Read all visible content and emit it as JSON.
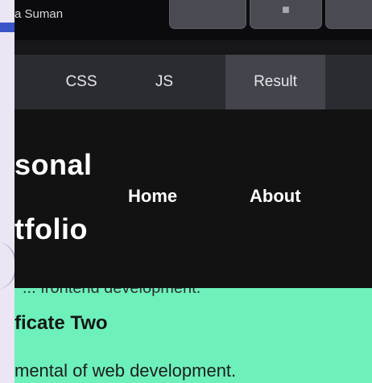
{
  "editor": {
    "author": "a Suman",
    "toolbar_buttons": [
      {
        "icon": "toolbar-button-icon"
      },
      {
        "icon": "toolbar-button-icon"
      },
      {
        "icon": "toolbar-button-icon"
      }
    ],
    "tabs": [
      {
        "label": "CSS",
        "active": false
      },
      {
        "label": "JS",
        "active": false
      },
      {
        "label": "Result",
        "active": true
      }
    ]
  },
  "result": {
    "logo": {
      "line1": "sonal",
      "line2": "tfolio"
    },
    "nav": {
      "home": "Home",
      "about": "About"
    },
    "content": {
      "cut_text": "... frontend development.",
      "cert_title": "ficate Two",
      "cert_desc": "mental of web development."
    }
  },
  "colors": {
    "editor_bg": "#0b0b0d",
    "tab_bar": "#2b2c31",
    "tab_active": "#43444c",
    "site_header": "#121212",
    "content_bg": "#6df0ba"
  }
}
